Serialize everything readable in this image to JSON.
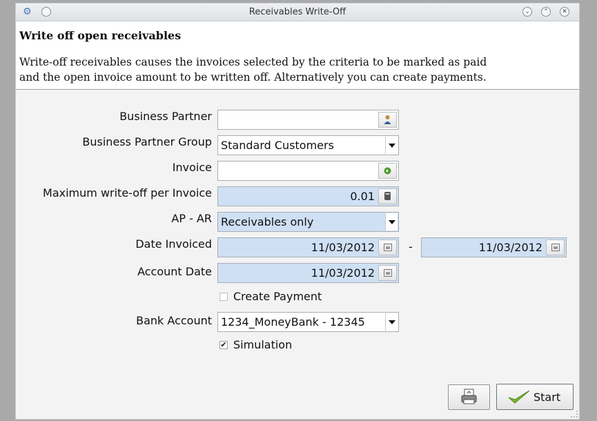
{
  "window": {
    "title": "Receivables Write-Off"
  },
  "header": {
    "title": "Write off open receivables",
    "description_line1": "Write-off receivables causes the invoices selected by the criteria to be marked as paid",
    "description_line2": "and the open invoice amount to be written off. Alternatively you can create payments."
  },
  "form": {
    "business_partner": {
      "label": "Business Partner",
      "value": ""
    },
    "bp_group": {
      "label": "Business Partner Group",
      "value": "Standard Customers"
    },
    "invoice": {
      "label": "Invoice",
      "value": ""
    },
    "max_writeoff": {
      "label": "Maximum write-off per Invoice",
      "value": "0.01"
    },
    "ap_ar": {
      "label": "AP - AR",
      "value": "Receivables only"
    },
    "date_invoiced": {
      "label": "Date Invoiced",
      "from": "11/03/2012",
      "separator": "-",
      "to": "11/03/2012"
    },
    "account_date": {
      "label": "Account Date",
      "value": "11/03/2012"
    },
    "create_payment": {
      "label": "Create Payment",
      "checked": false,
      "mark": ""
    },
    "bank_account": {
      "label": "Bank Account",
      "value": "1234_MoneyBank - 12345"
    },
    "simulation": {
      "label": "Simulation",
      "checked": true,
      "mark": "✔"
    }
  },
  "buttons": {
    "start_label": "Start"
  },
  "colors": {
    "mandatory_bg": "#cfe0f5",
    "titlebar_bg": "#e4e7ea",
    "checkmark_green": "#7ab52f"
  },
  "icons": [
    "settings-icon",
    "minimize-icon",
    "maximize-icon",
    "close-icon",
    "person-icon",
    "zoom-green-icon",
    "calculator-icon",
    "calendar-icon",
    "print-icon",
    "checkmark-icon"
  ]
}
